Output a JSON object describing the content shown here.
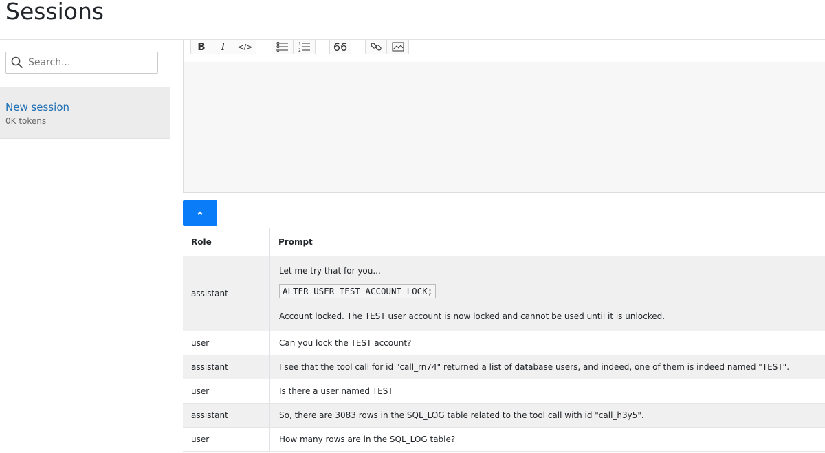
{
  "header": {
    "title": "Sessions"
  },
  "sidebar": {
    "search": {
      "placeholder": "Search..."
    },
    "sessions": [
      {
        "name": "New session",
        "tokens": "0K tokens"
      }
    ]
  },
  "toolbar": {
    "bold": "B",
    "italic": "I",
    "code": "</>",
    "quote": "66"
  },
  "table": {
    "headers": {
      "role": "Role",
      "prompt": "Prompt"
    },
    "rows": [
      {
        "role": "assistant",
        "line1": "Let me try that for you...",
        "code": "ALTER USER TEST ACCOUNT LOCK;",
        "line2": "Account locked. The TEST user account is now locked and cannot be used until it is unlocked."
      },
      {
        "role": "user",
        "prompt": "Can you lock the TEST account?"
      },
      {
        "role": "assistant",
        "prompt": "I see that the tool call for id \"call_rn74\" returned a list of database users, and indeed, one of them is indeed named \"TEST\"."
      },
      {
        "role": "user",
        "prompt": "Is there a user named TEST"
      },
      {
        "role": "assistant",
        "prompt": "So, there are 3083 rows in the SQL_LOG table related to the tool call with id \"call_h3y5\"."
      },
      {
        "role": "user",
        "prompt": "How many rows are in the SQL_LOG table?"
      }
    ]
  },
  "colors": {
    "accent": "#0a7cf7",
    "link": "#1f6fb5"
  }
}
